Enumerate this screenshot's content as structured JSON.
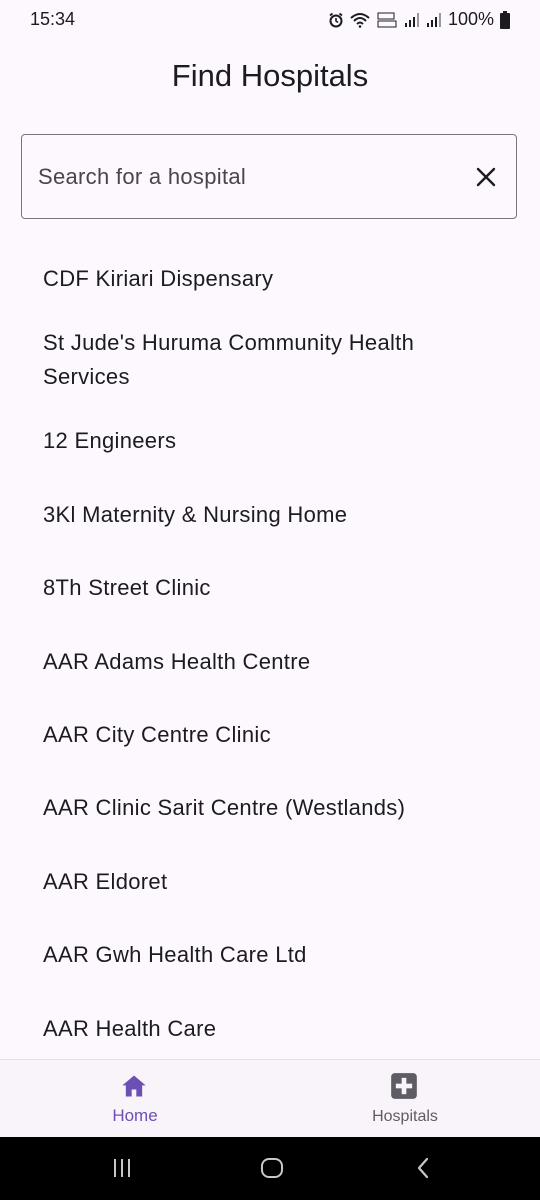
{
  "status_bar": {
    "time": "15:34",
    "battery": "100%"
  },
  "header": {
    "title": "Find Hospitals"
  },
  "search": {
    "placeholder": "Search for a hospital"
  },
  "hospitals": [
    " CDF Kiriari Dispensary",
    " St Jude's Huruma Community Health Services",
    "12 Engineers",
    "3Kl Maternity & Nursing Home",
    "8Th Street Clinic",
    "AAR Adams Health Centre",
    "AAR City Centre Clinic",
    "AAR Clinic Sarit Centre (Westlands)",
    "AAR Eldoret",
    "AAR Gwh Health Care Ltd",
    "AAR Health Care"
  ],
  "bottom_nav": {
    "items": [
      {
        "label": "Home",
        "icon": "home-icon",
        "active": true
      },
      {
        "label": "Hospitals",
        "icon": "hospital-icon",
        "active": false
      }
    ],
    "active_color": "#6b4fb3"
  },
  "colors": {
    "background": "#fdf8fd",
    "accent": "#6b4fb3"
  }
}
